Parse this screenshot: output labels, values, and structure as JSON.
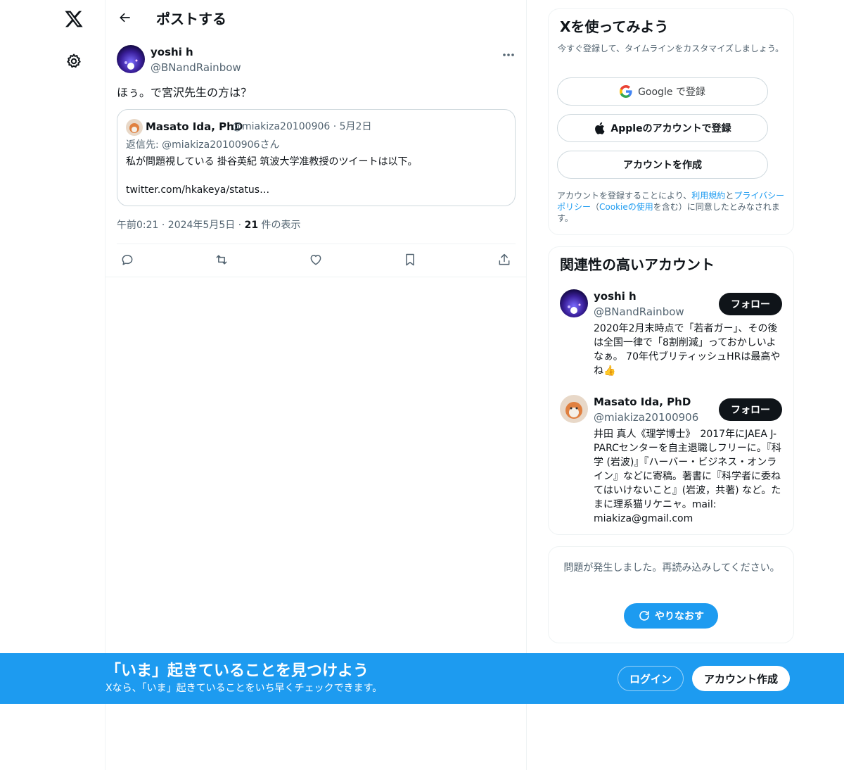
{
  "header": {
    "title": "ポストする"
  },
  "tweet": {
    "author_name": "yoshi h",
    "author_handle": "@BNandRainbow",
    "text": "ほぅ。で宮沢先生の方は？",
    "quote": {
      "name": "Masato Ida, PhD",
      "handle_date": "@miakiza20100906 · 5月2日",
      "reply_to": "返信先: @miakiza20100906さん",
      "body": "私が問題視している 掛谷英紀 筑波大学准教授のツイートは以下。",
      "link": "twitter.com/hkakeya/status…"
    },
    "time": "午前0:21 · 2024年5月5日 · ",
    "views_count": "21",
    "views_label": " 件の表示"
  },
  "signup": {
    "title": "Xを使ってみよう",
    "subtitle": "今すぐ登録して、タイムラインをカスタマイズしましょう。",
    "google_label": "Google で登録",
    "apple_label": "Appleのアカウントで登録",
    "create_label": "アカウントを作成",
    "terms_prefix": "アカウントを登録することにより、",
    "terms_link": "利用規約",
    "terms_and": "と",
    "privacy_link": "プライバシーポリシー",
    "terms_open": "（",
    "cookie_link": "Cookieの使用",
    "terms_suffix": "を含む）に同意したとみなされます。"
  },
  "related": {
    "title": "関連性の高いアカウント",
    "accounts": [
      {
        "name": "yoshi h",
        "handle": "@BNandRainbow",
        "bio": "2020年2月末時点で「若者ガー」、その後は全国一律で「8割削減」っておかしいよなぁ。 70年代ブリティッシュHRは最高やね👍",
        "follow_label": "フォロー"
      },
      {
        "name": "Masato Ida, PhD",
        "handle": "@miakiza20100906",
        "bio": "井田 真人《理学博士》　2017年にJAEA J-PARCセンターを自主退職しフリーに。『科学 (岩波)』『ハーバー・ビジネス・オンライン』などに寄稿。著書に『科学者に委ねてはいけないこと』(岩波，共著) など。たまに理系猫リケニャ。mail: miakiza@gmail.com",
        "follow_label": "フォロー"
      }
    ]
  },
  "error": {
    "message": "問題が発生しました。再読み込みしてください。",
    "retry_label": "やりなおす"
  },
  "banner": {
    "title": "「いま」起きていることを見つけよう",
    "subtitle": "Xなら、「いま」起きていることをいち早くチェックできます。",
    "login_label": "ログイン",
    "signup_label": "アカウント作成"
  },
  "icons": {
    "logo": "x-logo-icon",
    "settings": "gear-icon",
    "back": "arrow-left-icon",
    "more": "more-horizontal-icon",
    "reply": "reply-icon",
    "repost": "repost-icon",
    "like": "heart-icon",
    "bookmark": "bookmark-icon",
    "share": "share-icon",
    "google": "google-icon",
    "apple": "apple-icon",
    "refresh": "refresh-icon"
  },
  "colors": {
    "accent": "#1d9bf0",
    "text": "#0f1419",
    "muted": "#536471"
  }
}
